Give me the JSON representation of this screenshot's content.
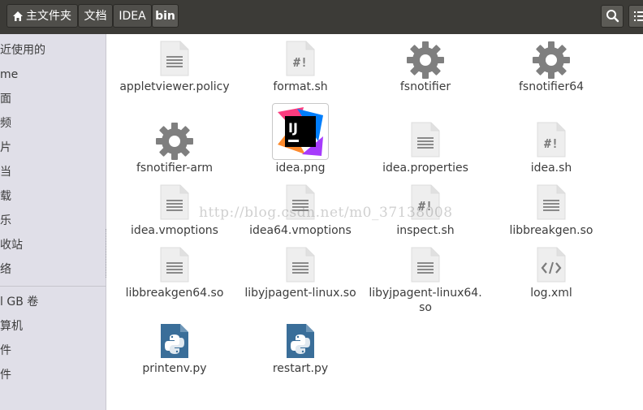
{
  "breadcrumb": [
    {
      "label": "主文件夹",
      "icon": "home-icon"
    },
    {
      "label": "文档"
    },
    {
      "label": "IDEA"
    },
    {
      "label": "bin",
      "active": true
    }
  ],
  "sidebar": {
    "items": [
      "近使用的",
      "me",
      "面",
      "频",
      "片",
      "当",
      "载",
      "乐",
      "收站",
      "络",
      "l GB 卷",
      "算机",
      "件",
      "件"
    ]
  },
  "files": [
    {
      "name": "appletviewer.policy",
      "icon": "text-file-icon"
    },
    {
      "name": "format.sh",
      "icon": "script-file-icon"
    },
    {
      "name": "fsnotifier",
      "icon": "executable-gear-icon"
    },
    {
      "name": "fsnotifier64",
      "icon": "executable-gear-icon"
    },
    {
      "name": "fsnotifier-arm",
      "icon": "executable-gear-icon"
    },
    {
      "name": "idea.png",
      "icon": "intellij-logo-icon"
    },
    {
      "name": "idea.properties",
      "icon": "text-file-icon"
    },
    {
      "name": "idea.sh",
      "icon": "script-file-icon"
    },
    {
      "name": "idea.vmoptions",
      "icon": "text-file-icon"
    },
    {
      "name": "idea64.vmoptions",
      "icon": "text-file-icon"
    },
    {
      "name": "inspect.sh",
      "icon": "script-file-icon"
    },
    {
      "name": "libbreakgen.so",
      "icon": "text-file-icon"
    },
    {
      "name": "libbreakgen64.so",
      "icon": "text-file-icon"
    },
    {
      "name": "libyjpagent-linux.so",
      "icon": "text-file-icon"
    },
    {
      "name": "libyjpagent-linux64.",
      "name2": "so",
      "icon": "text-file-icon"
    },
    {
      "name": "log.xml",
      "icon": "xml-file-icon"
    },
    {
      "name": "printenv.py",
      "icon": "python-file-icon"
    },
    {
      "name": "restart.py",
      "icon": "python-file-icon"
    }
  ],
  "watermark": "http://blog.csdn.net/m0_37138008",
  "colors": {
    "topbar": "#3c3b37",
    "sidebar": "#e0dfe8",
    "python": "#3a6e99",
    "gear": "#7f7f7f"
  }
}
